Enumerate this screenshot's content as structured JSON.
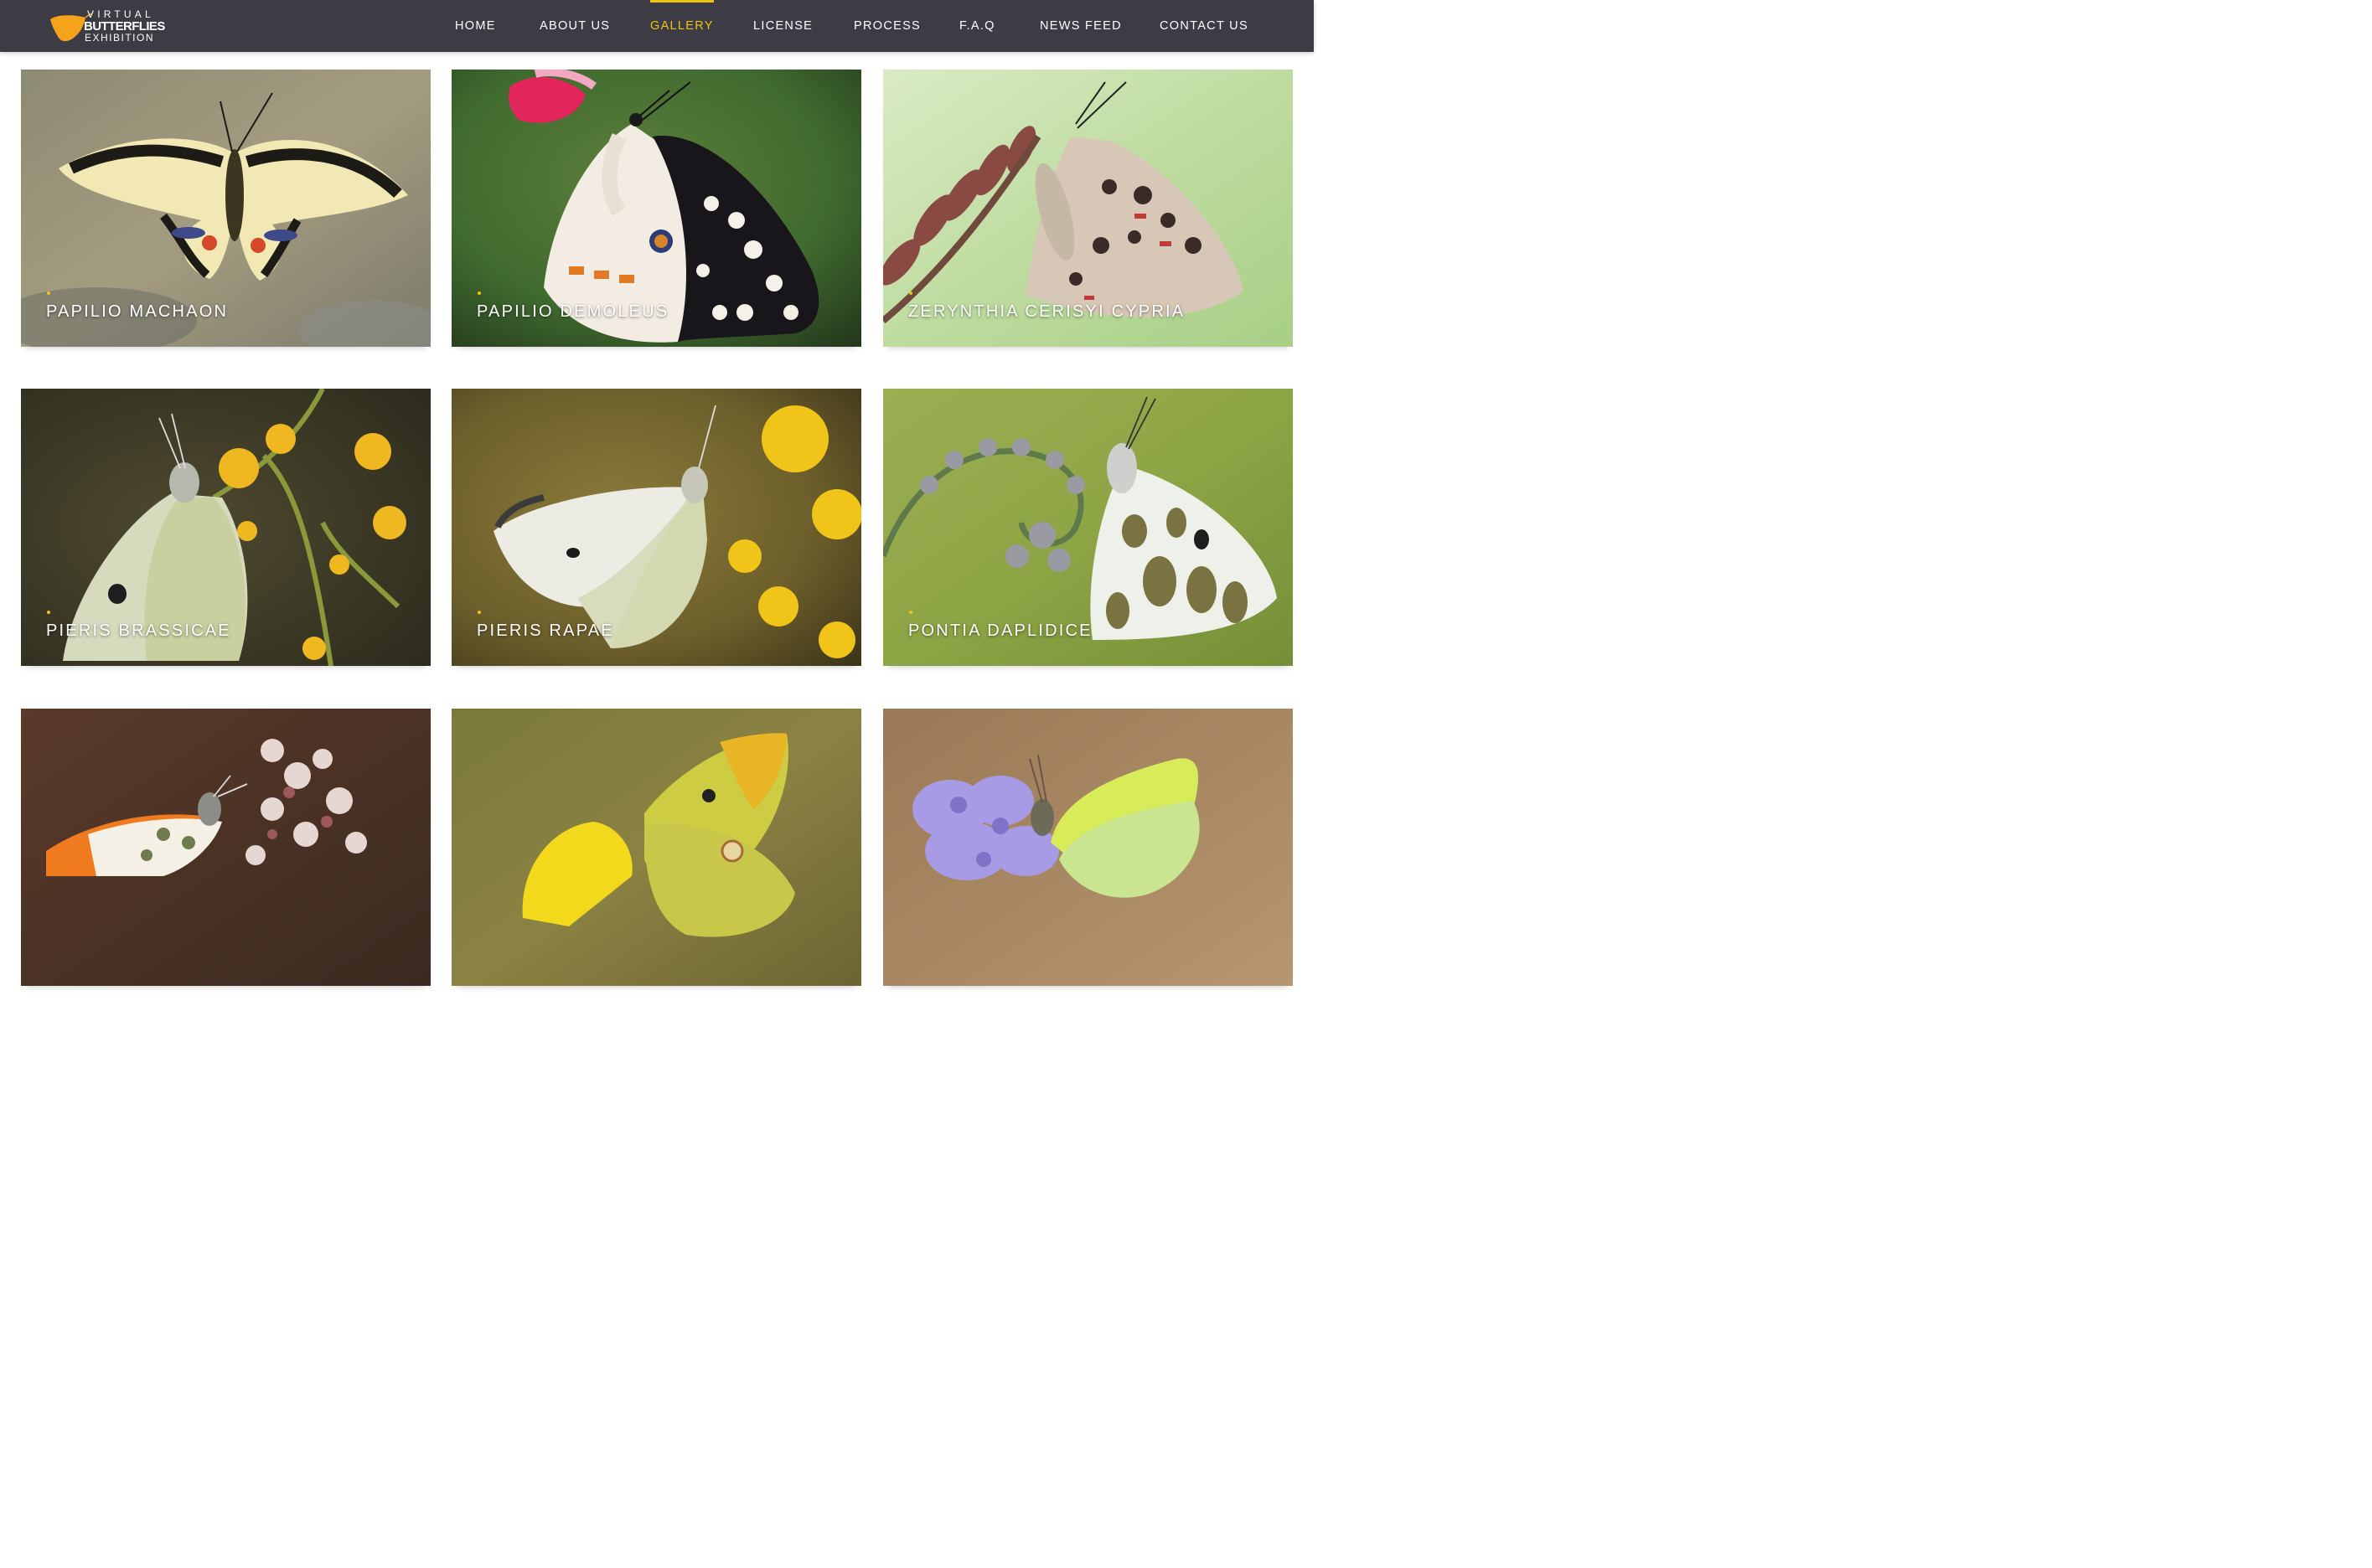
{
  "header": {
    "logo": {
      "line1": "VIRTUAL",
      "line2": "BUTTERFLIES",
      "line3": "EXHIBITION"
    },
    "nav": [
      {
        "label": "HOME",
        "active": false
      },
      {
        "label": "ABOUT US",
        "active": false
      },
      {
        "label": "GALLERY",
        "active": true
      },
      {
        "label": "LICENSE",
        "active": false
      },
      {
        "label": "PROCESS",
        "active": false
      },
      {
        "label": "F.A.Q",
        "active": false
      },
      {
        "label": "NEWS FEED",
        "active": false
      },
      {
        "label": "CONTACT US",
        "active": false
      }
    ]
  },
  "gallery": {
    "items": [
      {
        "caption": "PAPILIO MACHAON"
      },
      {
        "caption": "PAPILIO DEMOLEUS"
      },
      {
        "caption": "ZERYNTHIA CERISYI CYPRIA"
      },
      {
        "caption": "PIERIS BRASSICAE"
      },
      {
        "caption": "PIERIS RAPAE"
      },
      {
        "caption": "PONTIA DAPLIDICE"
      },
      {
        "caption": ""
      },
      {
        "caption": ""
      },
      {
        "caption": ""
      }
    ]
  },
  "colors": {
    "header_bg": "#3d3c45",
    "accent": "#f1c40f",
    "logo_orange": "#f7a21b"
  }
}
